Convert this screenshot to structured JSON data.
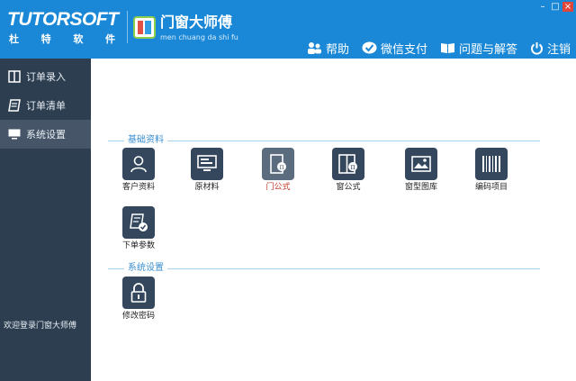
{
  "brand": {
    "name": "TUTORSOFT",
    "subtitle": [
      "杜",
      "特",
      "软",
      "件"
    ]
  },
  "product": {
    "name": "门窗大师傅",
    "pinyin": "men chuang da shi fu"
  },
  "window_controls": {
    "minimize": "–",
    "maximize": "□",
    "close": "×"
  },
  "toolbar": [
    {
      "label": "帮助",
      "icon": "people-help-icon"
    },
    {
      "label": "微信支付",
      "icon": "wechat-pay-icon"
    },
    {
      "label": "问题与解答",
      "icon": "book-icon"
    },
    {
      "label": "注销",
      "icon": "power-icon"
    }
  ],
  "sidebar": {
    "items": [
      {
        "label": "订单录入",
        "icon": "order-entry-icon",
        "active": false
      },
      {
        "label": "订单清单",
        "icon": "order-list-icon",
        "active": false
      },
      {
        "label": "系统设置",
        "icon": "monitor-settings-icon",
        "active": true
      }
    ],
    "welcome": "欢迎登录门窗大师傅"
  },
  "sections": [
    {
      "title": "基础资料",
      "tiles": [
        {
          "label": "客户资料",
          "icon": "user-icon"
        },
        {
          "label": "原材料",
          "icon": "monitor-material-icon"
        },
        {
          "label": "门公式",
          "icon": "door-formula-icon",
          "selected": true
        },
        {
          "label": "窗公式",
          "icon": "window-formula-icon"
        },
        {
          "label": "窗型图库",
          "icon": "image-gallery-icon"
        },
        {
          "label": "编码项目",
          "icon": "barcode-icon"
        },
        {
          "label": "下单参数",
          "icon": "order-params-icon"
        }
      ]
    },
    {
      "title": "系统设置",
      "tiles": [
        {
          "label": "修改密码",
          "icon": "lock-icon"
        }
      ]
    }
  ],
  "colors": {
    "header": "#1a88d6",
    "sidebar": "#2c3e50",
    "sidebar_active": "#465668",
    "tile_icon_bg": "#34475d",
    "section_title": "#3a8ed0",
    "selected_label": "#c0392b"
  }
}
